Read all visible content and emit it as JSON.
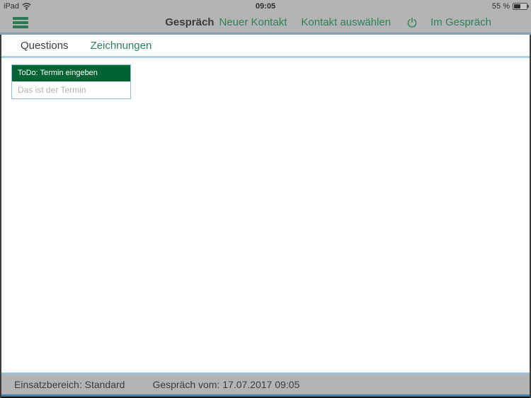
{
  "status_bar": {
    "device": "iPad",
    "time": "09:05",
    "battery_percent": "55 %",
    "battery_level": 0.55
  },
  "nav_bar": {
    "title": "Gespräch",
    "new_contact": "Neuer Kontakt",
    "select_contact": "Kontakt auswählen",
    "in_conversation": "Im Gespräch"
  },
  "tabs": [
    {
      "label": "Questions",
      "active": false
    },
    {
      "label": "Zeichnungen",
      "active": true
    }
  ],
  "content": {
    "todo_card": {
      "header": "ToDo: Termin eingeben",
      "placeholder": "Das ist der Termin",
      "value": ""
    }
  },
  "footer": {
    "area_label": "Einsatzbereich: Standard",
    "conversation_label": "Gespräch vom: 17.07.2017 09:05"
  },
  "icons": {
    "menu": "hamburger-menu",
    "wifi": "wifi-signal",
    "battery": "battery-55",
    "power": "power-symbol"
  },
  "colors": {
    "bar_gray": "#b4b4b4",
    "accent_green": "#2d825a",
    "header_green": "#006333",
    "nav_separator_blue": "#7fa3be",
    "tab_border_blue": "#abcfe3",
    "card_border_blue": "#8cbcdc",
    "footer_border_blue": "#9cc3d6",
    "bottom_line_blue": "#3d80b2",
    "dark_text": "#3b3b3b"
  }
}
